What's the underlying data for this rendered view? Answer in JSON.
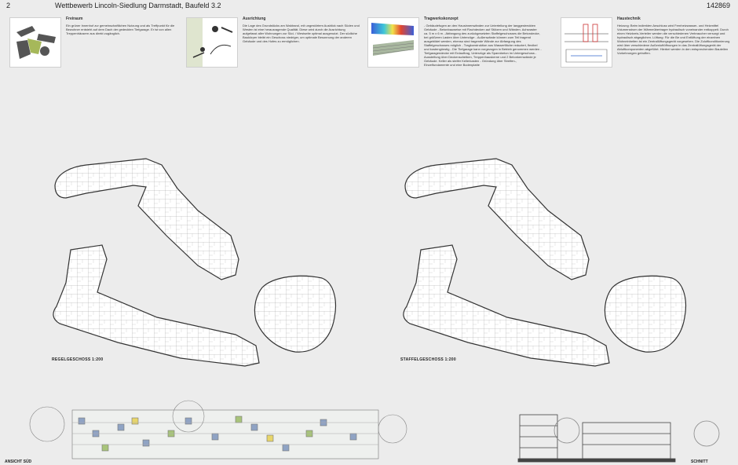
{
  "header": {
    "page_number": "2",
    "title": "Wettbewerb Lincoln-Siedlung Darmstadt, Baufeld 3.2",
    "project_id": "142869"
  },
  "cards": [
    {
      "title": "Freiraum",
      "text": "Ein grüner Innenhof zur gemeinschaftlichen Nutzung und als Treffpunkt für die Bewohner entsteht auf dem Dach der gedeckten Tiefgarage. Er ist von allen Treppenhäusern aus direkt zugänglich."
    },
    {
      "title": "Ausrichtung",
      "text": "Die Lage des Grundstücks am Waldrand, mit ungestörtem Ausblick nach Süden und Westen ist eine herausragende Qualität. Diese wird durch die Ausrichtung aufgefasst aller Wohnungen zur Süd- / Westseite optimal ausgenutzt. Der südliche Baukörper bleibt ein Geschoss niedriger, um optimale Besonnung der anderen Gebäude und des Hofes zu ermöglichen."
    },
    {
      "title": "Tragwerkskonzept",
      "text": "- Gebäudefugen an den Hausinnenwänden zur Unterteilung der langgestreckten Gebäude - Betonbauweise mit Flachdecken auf Stützen und Wänden. Achsraster ca. 5 m x 6 m - Abfangung des zurückgesetzten Staffelgeschosses die Betondecke, bei größeren Lasten über Unterzüge - Außenwände können zum Teil tragend ausgebildet werden, ebenso sind tragende Wände zur Abfangung des Staffelgeschosses möglich - Tragkonstruktion aus Wasserfläche reduziert, flexibel und kostengünstig - Die Tiefgarage kann vorgezogen in Betrieb genommen werden - Tiefgaragendecke mit Erdauftrag, Unterzüge als Spannbeton im Untergeschoss - Aussteifung über Deckenscheiben, Treppenhauskerne und 2 Betonkernwände je Gebäude. Keller als steifer Kellerkasten - Gründung über Streifen-, Einzelfundamente und eine Bodenplatte"
    },
    {
      "title": "Haustechnik",
      "text": "Heizung: Beim indirekten Anschluss wird Fernheizwasser- und Heizmittel Volumenstrom der Wärmeübertrager hydraulisch voneinander entkoppelt. Durch einen Heizkreis-Verteiler werden die verschiedenen Verbraucher versorgt und hydraulisch abgeglichen. Lüftung: Für die Be und Entlüftung der einzelnen Wohneinheiten ist ein Zentrallüftungsgerät vorgesehen. Die Zuluftkonditionierung wird über verschiedene Außenluftöffnungen in das Zentrallüftungsgerät der Abluftkomponenten abgeführt. Hierbei werden in den entsprechenden Bauteilen Vorkehrungen getroffen."
    }
  ],
  "plans": {
    "left_label": "REGELGESCHOSS 1:200",
    "right_label": "STAFFELGESCHOSS 1:200"
  },
  "footer": {
    "left_label": "ANSICHT SÜD",
    "right_label": "SCHNITT"
  }
}
